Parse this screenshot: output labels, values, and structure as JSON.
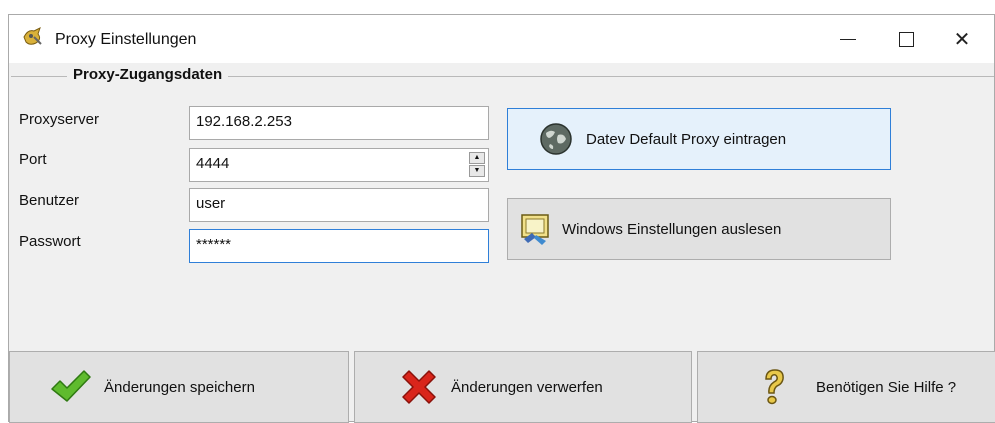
{
  "window": {
    "title": "Proxy Einstellungen",
    "icon": "proxy-app-icon",
    "controls": {
      "minimize": "minimize-icon",
      "maximize": "maximize-icon",
      "close": "close-icon"
    }
  },
  "group": {
    "legend": "Proxy-Zugangsdaten"
  },
  "form": {
    "proxy_label": "Proxyserver",
    "proxy_value": "192.168.2.253",
    "port_label": "Port",
    "port_value": "4444",
    "user_label": "Benutzer",
    "user_value": "user",
    "pass_label": "Passwort",
    "pass_value": "******"
  },
  "actions": {
    "datev_label": "Datev Default Proxy eintragen",
    "windows_label": "Windows Einstellungen auslesen"
  },
  "footer": {
    "save_label": "Änderungen speichern",
    "discard_label": "Änderungen verwerfen",
    "help_label": "Benötigen Sie Hilfe ?"
  },
  "colors": {
    "focus": "#2f7fd8",
    "button": "#e1e1e1",
    "button_hover": "#e5f1fb",
    "background": "#f0f0f0"
  }
}
